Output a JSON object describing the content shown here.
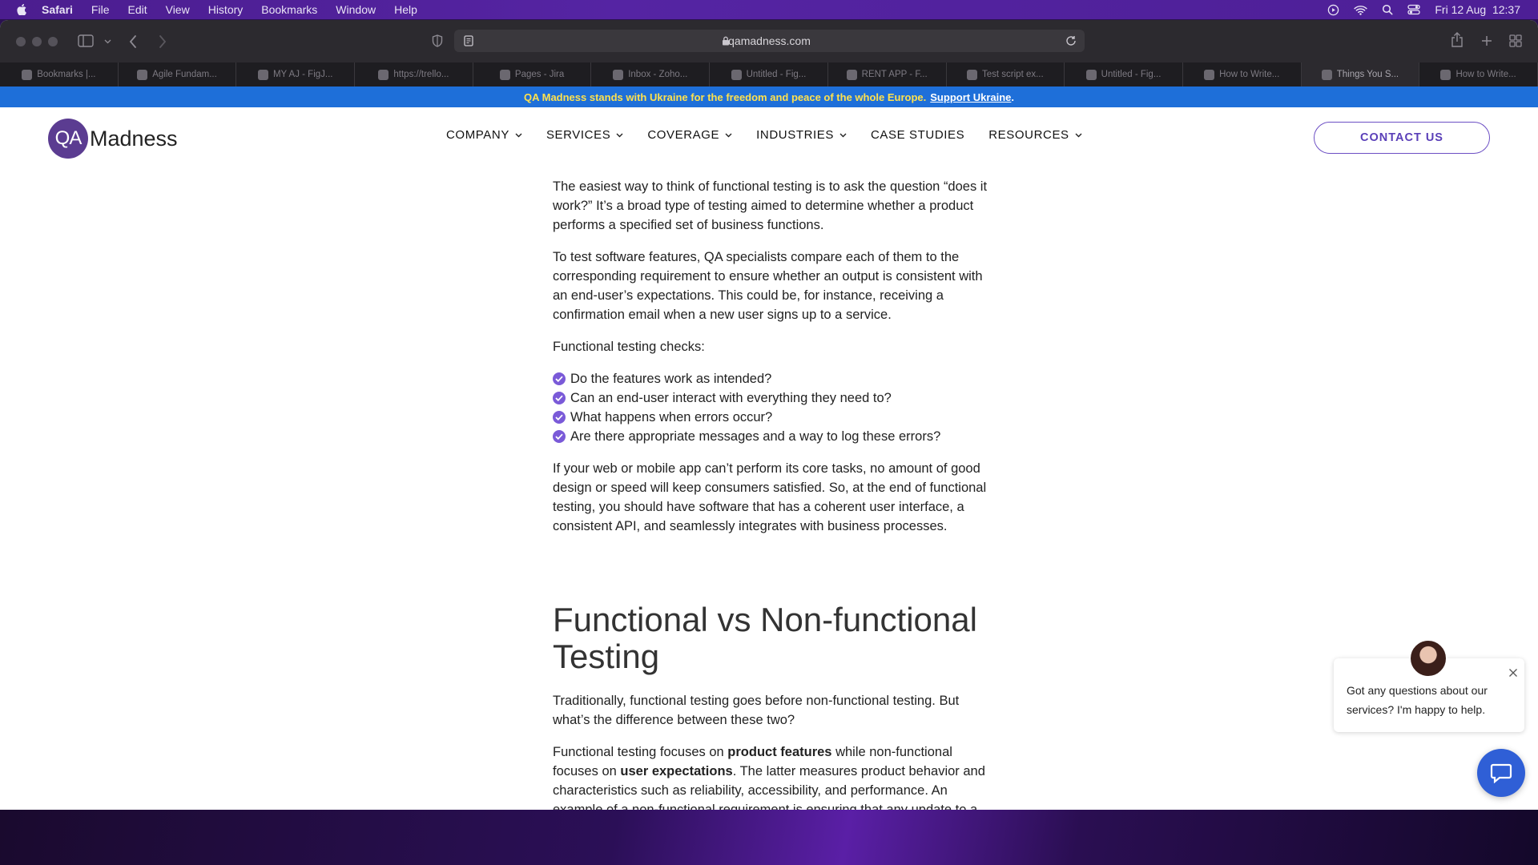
{
  "menubar": {
    "app": "Safari",
    "items": [
      "File",
      "Edit",
      "View",
      "History",
      "Bookmarks",
      "Window",
      "Help"
    ],
    "clock": "Fri 12 Aug  12:37"
  },
  "browser": {
    "url": "qamadness.com",
    "tabs": [
      {
        "label": "Bookmarks |..."
      },
      {
        "label": "Agile Fundam..."
      },
      {
        "label": "MY AJ - FigJ..."
      },
      {
        "label": "https://trello..."
      },
      {
        "label": "Pages - Jira"
      },
      {
        "label": "Inbox - Zoho..."
      },
      {
        "label": "Untitled - Fig..."
      },
      {
        "label": "RENT APP - F..."
      },
      {
        "label": "Test script ex..."
      },
      {
        "label": "Untitled - Fig..."
      },
      {
        "label": "How to Write..."
      },
      {
        "label": "Things You S..."
      },
      {
        "label": "How to Write..."
      }
    ],
    "active_tab_index": 11
  },
  "banner": {
    "text": "QA Madness stands with Ukraine for the freedom and peace of the whole Europe.",
    "link": "Support Ukraine",
    "suffix": "."
  },
  "header": {
    "logo_mark": "QA",
    "logo_text": "Madness",
    "nav": {
      "company": "COMPANY",
      "services": "SERVICES",
      "coverage": "COVERAGE",
      "industries": "INDUSTRIES",
      "case_studies": "CASE STUDIES",
      "resources": "RESOURCES"
    },
    "contact": "CONTACT US"
  },
  "article": {
    "p1_lines": [
      "The easiest way to think of functional testing is to ask the question “does it",
      "work?” It’s a broad type of testing aimed to determine whether a product",
      "performs a specified set of business functions."
    ],
    "p2_lines": [
      "To test software features, QA specialists compare each of them to the",
      "corresponding requirement to ensure whether an output is consistent with",
      "an end-user’s expectations. This could be, for instance, receiving a",
      "confirmation email when a new user signs up to a service."
    ],
    "checks_intro": "Functional testing checks:",
    "checks": [
      "Do the features work as intended?",
      "Can an end-user interact with everything they need to?",
      "What happens when errors occur?",
      "Are there appropriate messages and a way to log these errors?"
    ],
    "p3_lines": [
      "If your web or mobile app can’t perform its core tasks, no amount of good",
      "design or speed will keep consumers satisfied. So, at the end of functional",
      "testing, you should have software that has a coherent user interface, a",
      "consistent API, and seamlessly integrates with business processes."
    ],
    "heading_lines": [
      "Functional vs Non-functional",
      "Testing"
    ],
    "p4_lines": [
      "Traditionally, functional testing goes before non-functional testing. But",
      "what’s the difference between these two?"
    ],
    "p5": {
      "l1_a": "Functional testing focuses on ",
      "l1_b": "product features",
      "l1_c": " while non-functional",
      "l2_a": "focuses on ",
      "l2_b": "user expectations",
      "l2_c": ". The latter measures product behavior and",
      "l3": "characteristics such as reliability, accessibility, and performance. An",
      "l4": "example of a non-functional requirement is ensuring that any update to a"
    }
  },
  "chat": {
    "message": "Got any questions about our services? I'm happy to help."
  }
}
